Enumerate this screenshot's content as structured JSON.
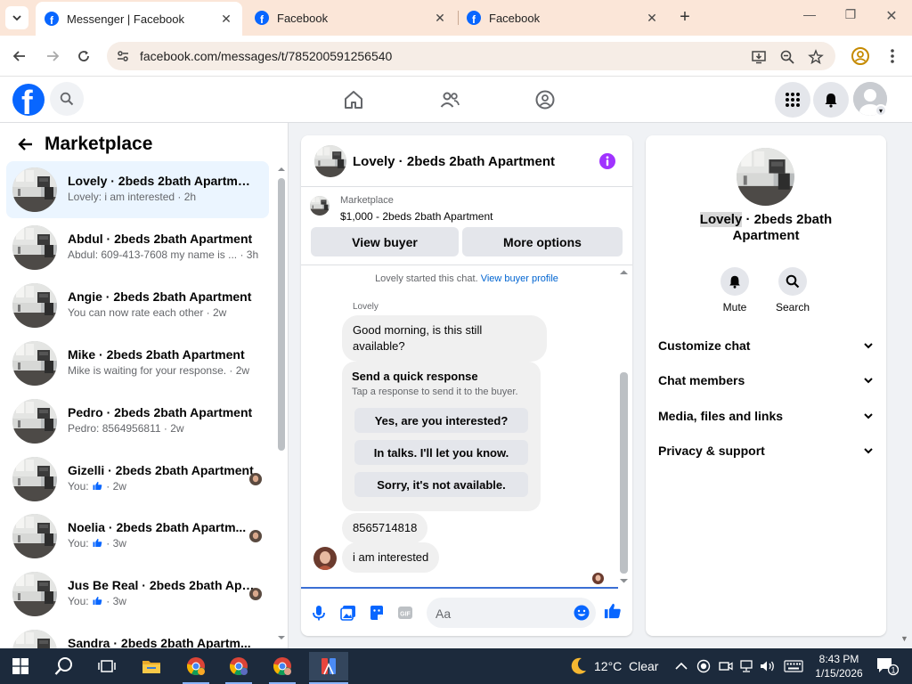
{
  "browser": {
    "tabs": [
      {
        "title": "Messenger | Facebook",
        "active": true
      },
      {
        "title": "Facebook",
        "active": false
      },
      {
        "title": "Facebook",
        "active": false
      }
    ],
    "url": "facebook.com/messages/t/785200591256540"
  },
  "left": {
    "title": "Marketplace",
    "conversations": [
      {
        "name": "Lovely · 2beds 2bath Apartment",
        "preview": "Lovely: i am interested · 2h",
        "active": true
      },
      {
        "name": "Abdul · 2beds 2bath Apartment",
        "preview": "Abdul: 609-413-7608 my name is ... · 3h"
      },
      {
        "name": "Angie · 2beds 2bath Apartment",
        "preview": "You can now rate each other · 2w"
      },
      {
        "name": "Mike · 2beds 2bath Apartment",
        "preview": "Mike is waiting for your response. · 2w"
      },
      {
        "name": "Pedro · 2beds 2bath Apartment",
        "preview": "Pedro: 8564956811 · 2w"
      },
      {
        "name": "Gizelli · 2beds 2bath Apartment",
        "preview_prefix": "You:",
        "preview_suffix": "· 2w",
        "has_like": true
      },
      {
        "name": "Noelia · 2beds 2bath Apartm...",
        "preview_prefix": "You:",
        "preview_suffix": "· 3w",
        "has_like": true
      },
      {
        "name": "Jus Be Real · 2beds 2bath Apa...",
        "preview_prefix": "You:",
        "preview_suffix": "· 3w",
        "has_like": true
      },
      {
        "name": "Sandra · 2beds 2bath Apartm...",
        "preview": ""
      }
    ]
  },
  "chat": {
    "title": "Lovely · 2beds 2bath Apartment",
    "listing_source": "Marketplace",
    "listing_price": "$1,000 - 2beds 2bath Apartment",
    "view_buyer": "View buyer",
    "more_options": "More options",
    "system_message": "Lovely started this chat.",
    "system_link": "View buyer profile",
    "sender": "Lovely",
    "msg1": "Good morning, is this still available?",
    "quick_title": "Send a quick response",
    "quick_sub": "Tap a response to send it to the buyer.",
    "quick_options": [
      "Yes, are you interested?",
      "In talks. I'll let you know.",
      "Sorry, it's not available."
    ],
    "msg2": "8565714818",
    "msg3": "i am interested",
    "input_placeholder": "Aa"
  },
  "right": {
    "name_highlight": "Lovely",
    "name_rest": " · 2beds 2bath",
    "name_line2": "Apartment",
    "mute": "Mute",
    "search": "Search",
    "sections": [
      "Customize chat",
      "Chat members",
      "Media, files and links",
      "Privacy & support"
    ]
  },
  "taskbar": {
    "weather_temp": "12°C",
    "weather_desc": "Clear",
    "time": "8:43 PM",
    "date": "1/15/2026",
    "notif_count": "1"
  },
  "colors": {
    "fb_blue": "#0866ff",
    "messenger_purple": "#a033ff",
    "link_blue": "#0064d1"
  }
}
